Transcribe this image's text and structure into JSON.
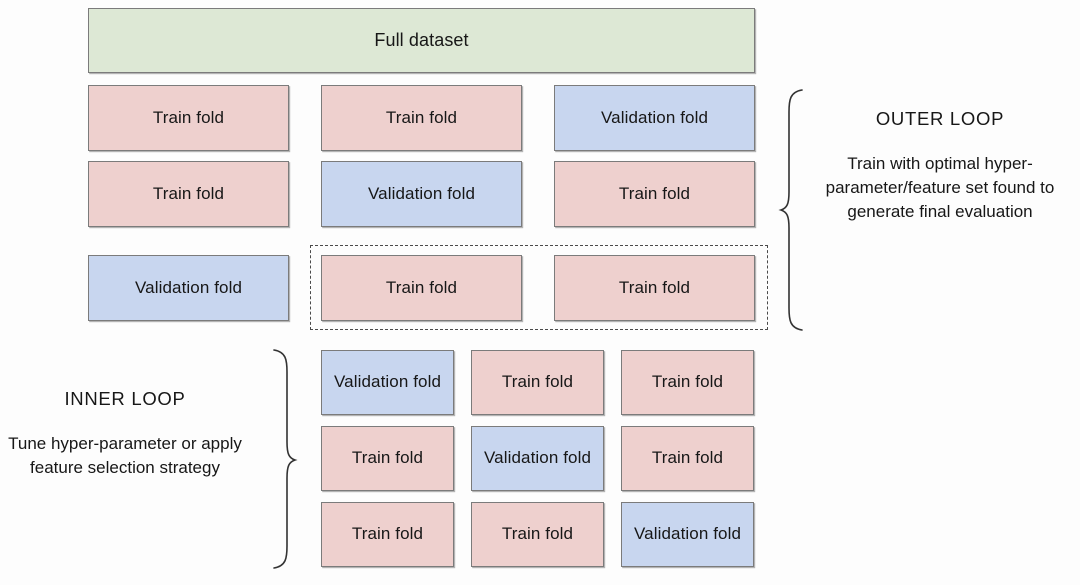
{
  "diagram": {
    "title_box": {
      "label": "Full dataset",
      "color": "#dde8d5"
    },
    "colors": {
      "train_fold": "#eed0ce",
      "validation_fold": "#c8d6ef",
      "full_dataset": "#dde8d5",
      "border": "#7b7b7b",
      "dashed_border": "#4a4a4a",
      "background": "#fdfdfd",
      "text": "#171717"
    },
    "outer_loop": {
      "rows": [
        {
          "cells": [
            {
              "label": "Train fold",
              "kind": "train"
            },
            {
              "label": "Train fold",
              "kind": "train"
            },
            {
              "label": "Validation fold",
              "kind": "validation"
            }
          ]
        },
        {
          "cells": [
            {
              "label": "Train fold",
              "kind": "train"
            },
            {
              "label": "Validation fold",
              "kind": "validation"
            },
            {
              "label": "Train fold",
              "kind": "train"
            }
          ]
        },
        {
          "cells": [
            {
              "label": "Validation fold",
              "kind": "validation"
            },
            {
              "label": "Train fold",
              "kind": "train"
            },
            {
              "label": "Train fold",
              "kind": "train"
            }
          ]
        }
      ],
      "annotation": {
        "title": "OUTER LOOP",
        "description": "Train with optimal hyper-parameter/feature set found to generate final evaluation"
      }
    },
    "inner_loop": {
      "rows": [
        {
          "cells": [
            {
              "label": "Validation fold",
              "kind": "validation"
            },
            {
              "label": "Train fold",
              "kind": "train"
            },
            {
              "label": "Train fold",
              "kind": "train"
            }
          ]
        },
        {
          "cells": [
            {
              "label": "Train fold",
              "kind": "train"
            },
            {
              "label": "Validation fold",
              "kind": "validation"
            },
            {
              "label": "Train fold",
              "kind": "train"
            }
          ]
        },
        {
          "cells": [
            {
              "label": "Train fold",
              "kind": "train"
            },
            {
              "label": "Train fold",
              "kind": "train"
            },
            {
              "label": "Validation fold",
              "kind": "validation"
            }
          ]
        }
      ],
      "annotation": {
        "title": "INNER LOOP",
        "description": "Tune hyper-parameter or apply feature selection strategy"
      }
    }
  }
}
